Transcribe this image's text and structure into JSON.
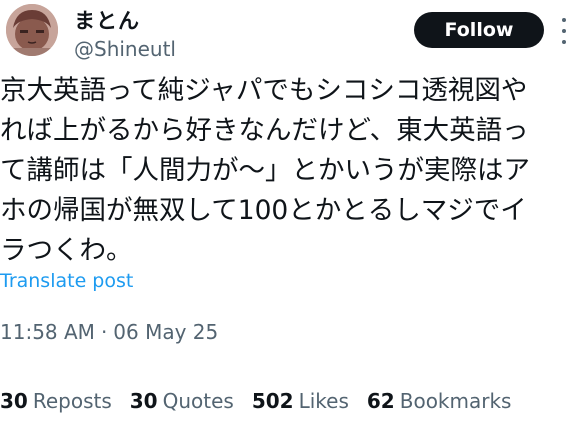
{
  "author": {
    "display_name": "まとん",
    "handle": "@Shineutl",
    "avatar_icon": "avatar-image"
  },
  "header": {
    "follow_label": "Follow",
    "more_icon": "more-options-icon"
  },
  "tweet": {
    "lines": [
      "京大英語って純ジャパでもシコシコ透視図や",
      "れば上がるから好きなんだけど、東大英語っ",
      "て講師は「人間力が〜」とかいうが実際はア",
      "ホの帰国が無双して100とかとるしマジでイ",
      "ラつくわ。"
    ],
    "translate_label": "Translate post",
    "time": "11:58 AM",
    "separator": "·",
    "date": "06 May 25"
  },
  "stats": {
    "reposts_count": "30",
    "reposts_label": "Reposts",
    "quotes_count": "30",
    "quotes_label": "Quotes",
    "likes_count": "502",
    "likes_label": "Likes",
    "bookmarks_count": "62",
    "bookmarks_label": "Bookmarks"
  },
  "colors": {
    "text_primary": "#0f1419",
    "text_secondary": "#536471",
    "link": "#1d9bf0",
    "follow_bg": "#0f1419",
    "follow_text": "#ffffff"
  }
}
